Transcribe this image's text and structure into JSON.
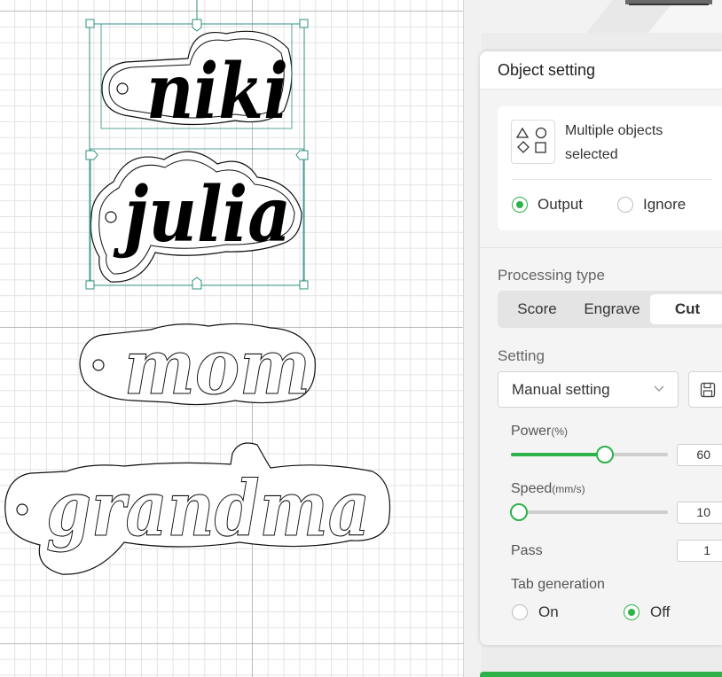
{
  "canvas": {
    "items": [
      {
        "text": "niki",
        "filled": true,
        "selected": true
      },
      {
        "text": "julia",
        "filled": true,
        "selected": true
      },
      {
        "text": "mom",
        "filled": false,
        "selected": false
      },
      {
        "text": "grandma",
        "filled": false,
        "selected": false
      }
    ]
  },
  "panel": {
    "title": "Object setting",
    "selection": {
      "line1": "Multiple objects",
      "line2": "selected",
      "output_label": "Output",
      "ignore_label": "Ignore",
      "mode": "Output"
    },
    "processing_type": {
      "label": "Processing type",
      "tabs": [
        "Score",
        "Engrave",
        "Cut"
      ],
      "active": "Cut"
    },
    "setting": {
      "label": "Setting",
      "value": "Manual setting"
    },
    "power": {
      "label": "Power",
      "unit": "(%)",
      "value": "60",
      "fraction": 0.6
    },
    "speed": {
      "label": "Speed",
      "unit": "(mm/s)",
      "value": "10",
      "fraction": 0.05
    },
    "pass": {
      "label": "Pass",
      "value": "1"
    },
    "tab_generation": {
      "label": "Tab generation",
      "on_label": "On",
      "off_label": "Off",
      "value": "Off"
    }
  },
  "colors": {
    "accent": "#2db24a",
    "selection": "#2f8f83"
  },
  "icons": [
    "shapes-icon",
    "chevron-down-icon",
    "save-icon"
  ]
}
